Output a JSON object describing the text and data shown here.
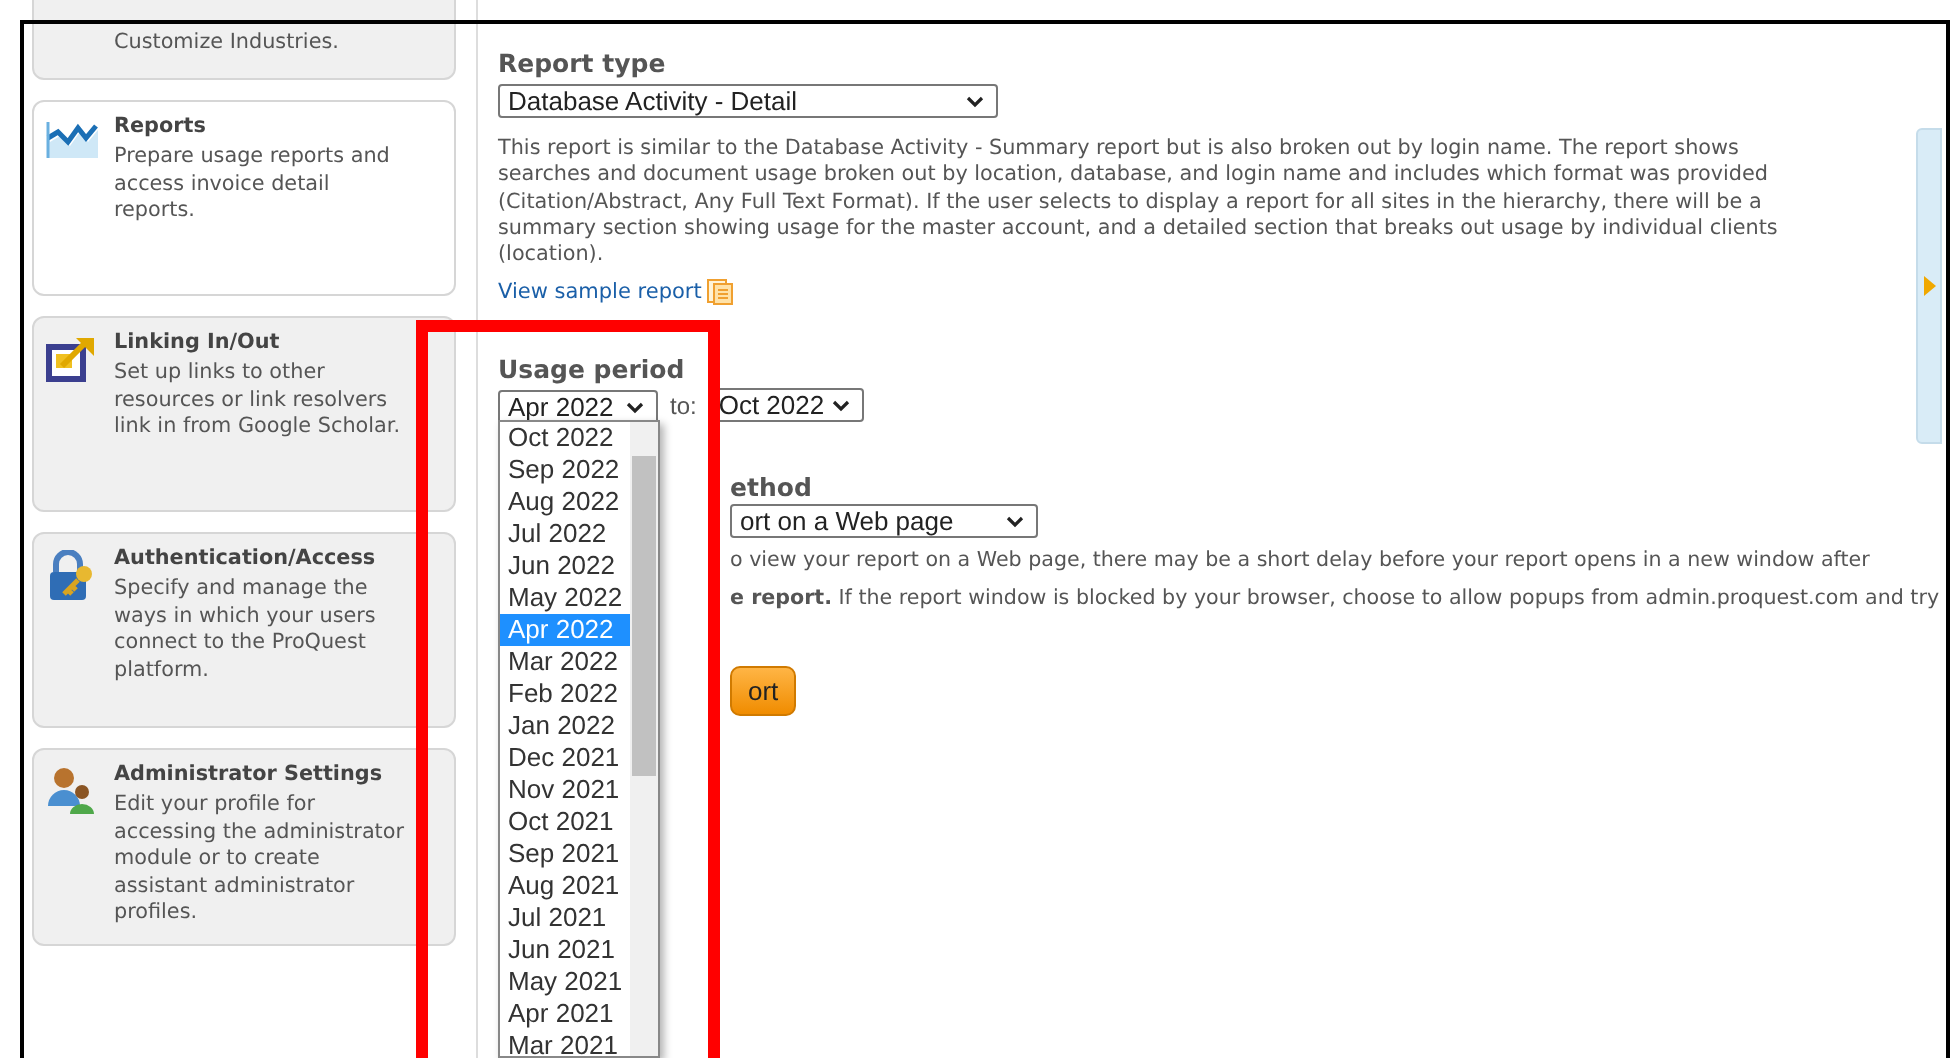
{
  "sidebar": {
    "items": [
      {
        "description": "Customize Industries.",
        "selected": false
      },
      {
        "title": "Reports",
        "description": "Prepare usage reports and access invoice detail reports.",
        "selected": true
      },
      {
        "title": "Linking In/Out",
        "description": "Set up links to other resources or link resolvers link in from Google Scholar.",
        "selected": false
      },
      {
        "title": "Authentication/Access",
        "description": "Specify and manage the ways in which your users connect to the ProQuest platform.",
        "selected": false
      },
      {
        "title": "Administrator Settings",
        "description": "Edit your profile for accessing the administrator module or to create assistant administrator profiles.",
        "selected": false
      }
    ]
  },
  "report_type": {
    "label": "Report type",
    "value": "Database Activity - Detail",
    "description": "This report is similar to the Database Activity - Summary report but is also broken out by login name. The report shows searches and document usage broken out by location, database, and login name and includes which format was provided (Citation/Abstract, Any Full Text Format). If the user selects to display a report for all sites in the hierarchy, there will be a summary section showing usage for the master account, and a detailed section that breaks out usage by individual clients (location).",
    "link": "View sample report"
  },
  "usage_period": {
    "label": "Usage period",
    "from": "Apr 2022",
    "to_label": "to:",
    "to": "Oct 2022",
    "dropdown": [
      {
        "label": "Oct 2022",
        "selected": false
      },
      {
        "label": "Sep 2022",
        "selected": false
      },
      {
        "label": "Aug 2022",
        "selected": false
      },
      {
        "label": "Jul 2022",
        "selected": false
      },
      {
        "label": "Jun 2022",
        "selected": false
      },
      {
        "label": "May 2022",
        "selected": false
      },
      {
        "label": "Apr 2022",
        "selected": true
      },
      {
        "label": "Mar 2022",
        "selected": false
      },
      {
        "label": "Feb 2022",
        "selected": false
      },
      {
        "label": "Jan 2022",
        "selected": false
      },
      {
        "label": "Dec 2021",
        "selected": false
      },
      {
        "label": "Nov 2021",
        "selected": false
      },
      {
        "label": "Oct 2021",
        "selected": false
      },
      {
        "label": "Sep 2021",
        "selected": false
      },
      {
        "label": "Aug 2021",
        "selected": false
      },
      {
        "label": "Jul 2021",
        "selected": false
      },
      {
        "label": "Jun 2021",
        "selected": false
      },
      {
        "label": "May 2021",
        "selected": false
      },
      {
        "label": "Apr 2021",
        "selected": false
      },
      {
        "label": "Mar 2021",
        "selected": false
      }
    ]
  },
  "delivery": {
    "label": "ethod",
    "value": "ort on a Web page",
    "notes": [
      "o view your report on a Web page, there may be a short delay before your report opens in a new window after",
      "**e report.** If the report window is blocked by your browser, choose to allow popups from admin.proquest.com and try"
    ],
    "button": "ort"
  }
}
